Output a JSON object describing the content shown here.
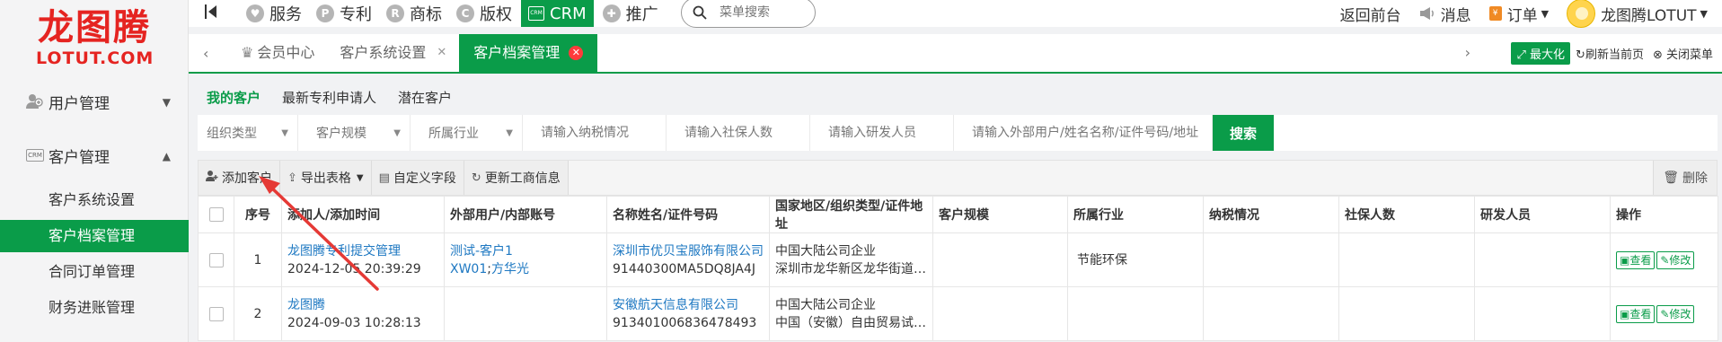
{
  "logo": {
    "cn": "龙图腾",
    "en": "LOTUT.COM"
  },
  "sidebar": {
    "groups": [
      {
        "label": "用户管理",
        "expanded": false
      },
      {
        "label": "客户管理",
        "expanded": true,
        "badge": "CRM"
      }
    ],
    "items": [
      {
        "label": "客户系统设置",
        "active": false
      },
      {
        "label": "客户档案管理",
        "active": true
      },
      {
        "label": "合同订单管理",
        "active": false
      },
      {
        "label": "财务进账管理",
        "active": false
      }
    ]
  },
  "topnav": {
    "items": [
      {
        "label": "服务",
        "icon": "service-icon"
      },
      {
        "label": "专利",
        "icon": "patent-icon"
      },
      {
        "label": "商标",
        "icon": "trademark-icon"
      },
      {
        "label": "版权",
        "icon": "copyright-icon"
      },
      {
        "label": "CRM",
        "icon": "crm-icon",
        "active": true
      },
      {
        "label": "推广",
        "icon": "promotion-icon"
      }
    ],
    "search_placeholder": "菜单搜索"
  },
  "topright": {
    "back": "返回前台",
    "messages": "消息",
    "orders": "订单",
    "user": "龙图腾LOTUT"
  },
  "tabs": {
    "items": [
      {
        "label": "会员中心",
        "closable": false
      },
      {
        "label": "客户系统设置",
        "closable": true
      },
      {
        "label": "客户档案管理",
        "closable": true,
        "active": true
      }
    ],
    "maximize": "最大化",
    "refresh": "刷新当前页",
    "close_menu": "关闭菜单"
  },
  "subtabs": [
    "我的客户",
    "最新专利申请人",
    "潜在客户"
  ],
  "filters": {
    "selects": [
      "组织类型",
      "客户规模",
      "所属行业"
    ],
    "inputs": [
      "请输入纳税情况",
      "请输入社保人数",
      "请输入研发人员",
      "请输入外部用户/姓名名称/证件号码/地址"
    ],
    "search_button": "搜索"
  },
  "toolbar": {
    "add": "添加客户",
    "export": "导出表格",
    "custom_fields": "自定义字段",
    "update_info": "更新工商信息",
    "delete": "删除"
  },
  "table": {
    "columns": [
      "序号",
      "添加人/添加时间",
      "外部用户/内部账号",
      "名称姓名/证件号码",
      "国家地区/组织类型/证件地址",
      "客户规模",
      "所属行业",
      "纳税情况",
      "社保人数",
      "研发人员",
      "操作"
    ],
    "rows": [
      {
        "index": "1",
        "adder": "龙图腾专利提交管理",
        "time": "2024-12-05 20:39:29",
        "external_user": "测试-客户1",
        "internal_account_code": "XW01",
        "internal_account_sep": ";",
        "internal_account_name": "方华光",
        "name": "深圳市优贝宝服饰有限公司",
        "id_no": "91440300MA5DQ8JA4J",
        "org_type": "中国大陆公司企业",
        "address": "深圳市龙华新区龙华街道美…",
        "scale": "",
        "industry": "节能环保",
        "tax": "",
        "social": "",
        "rd": ""
      },
      {
        "index": "2",
        "adder": "龙图腾",
        "time": "2024-09-03 10:28:13",
        "external_user": "",
        "internal_account_code": "",
        "internal_account_sep": "",
        "internal_account_name": "",
        "name": "安徽航天信息有限公司",
        "id_no": "913401006836478493",
        "org_type": "中国大陆公司企业",
        "address": "中国（安徽）自由贸易试验…",
        "scale": "",
        "industry": "",
        "tax": "",
        "social": "",
        "rd": ""
      }
    ],
    "actions": {
      "view": "查看",
      "edit": "修改"
    }
  },
  "colors": {
    "accent": "#0a9c49",
    "link": "#1e78c2",
    "logo": "#e52421",
    "arrow": "#e53935"
  }
}
